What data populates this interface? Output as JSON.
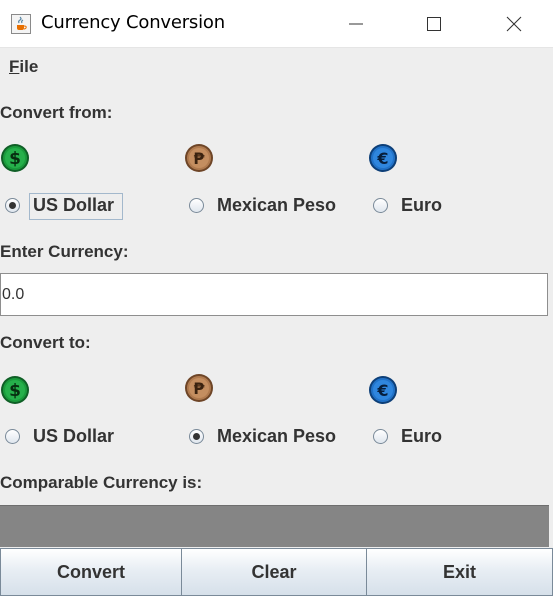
{
  "window": {
    "title": "Currency Conversion",
    "app_icon": "java-cup-icon"
  },
  "menu": {
    "file_mnemonic": "F",
    "file_rest": "ile"
  },
  "convert_from": {
    "label": "Convert from:",
    "options": [
      "US Dollar",
      "Mexican Peso",
      "Euro"
    ],
    "selected": "US Dollar"
  },
  "enter_currency": {
    "label": "Enter Currency:",
    "value": "0.0"
  },
  "convert_to": {
    "label": "Convert to:",
    "options": [
      "US Dollar",
      "Mexican Peso",
      "Euro"
    ],
    "selected": "Mexican Peso"
  },
  "result": {
    "label": "Comparable Currency is:",
    "value": ""
  },
  "buttons": {
    "convert": "Convert",
    "clear": "Clear",
    "exit": "Exit"
  },
  "colors": {
    "dollar_coin": "#1a9b3c",
    "peso_coin": "#b07a4e",
    "euro_coin": "#2172c8",
    "background": "#eeeeee",
    "result_bar": "#858585"
  },
  "icons": {
    "dollar": "dollar-coin-icon",
    "peso": "peso-coin-icon",
    "euro": "euro-coin-icon"
  }
}
